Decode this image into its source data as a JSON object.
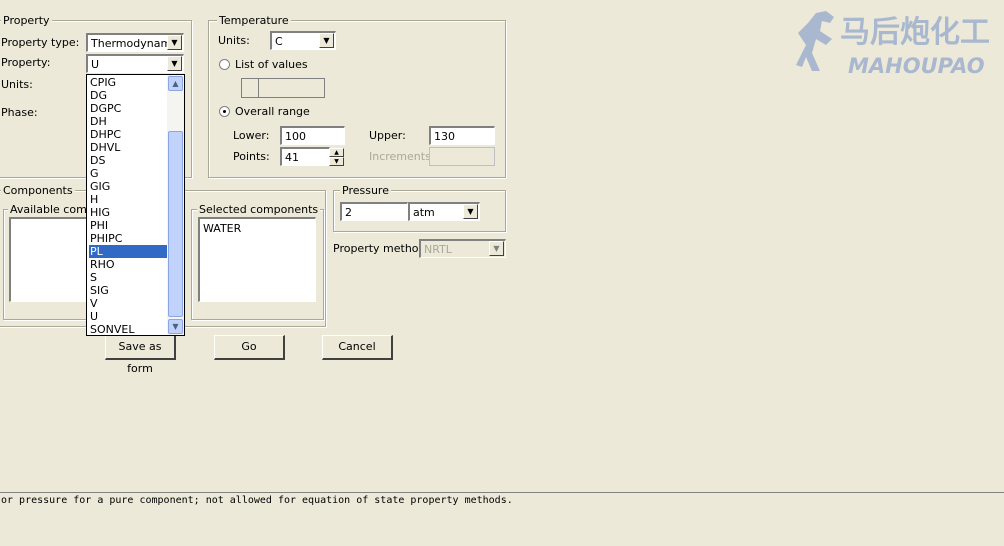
{
  "property": {
    "legend": "Property",
    "type_label": "Property type:",
    "type_value": "Thermodynamic",
    "property_label": "Property:",
    "property_value": "U",
    "units_label": "Units:",
    "phase_label": "Phase:",
    "dropdown_items": [
      "CPIG",
      "DG",
      "DGPC",
      "DH",
      "DHPC",
      "DHVL",
      "DS",
      "G",
      "GIG",
      "H",
      "HIG",
      "PHI",
      "PHIPC",
      "PL",
      "RHO",
      "S",
      "SIG",
      "V",
      "U",
      "SONVEL"
    ],
    "dropdown_selected": "PL"
  },
  "temperature": {
    "legend": "Temperature",
    "units_label": "Units:",
    "units_value": "C",
    "list_of_values_label": "List of values",
    "overall_range_label": "Overall range",
    "lower_label": "Lower:",
    "lower_value": "100",
    "upper_label": "Upper:",
    "upper_value": "130",
    "points_label": "Points:",
    "points_value": "41",
    "increments_label": "Increments:",
    "increments_value": ""
  },
  "components": {
    "legend": "Components",
    "available_legend": "Available compo",
    "selected_legend": "Selected components",
    "selected_items": [
      "WATER"
    ]
  },
  "pressure": {
    "legend": "Pressure",
    "value": "2",
    "units_value": "atm"
  },
  "property_method": {
    "label": "Property method:",
    "value": "NRTL"
  },
  "buttons": {
    "save_as_form": "Save as form",
    "go": "Go",
    "cancel": "Cancel"
  },
  "status_text": "or pressure for a pure component; not allowed for equation of state property methods.",
  "watermark": {
    "chinese": "马后炮化工",
    "latin": "MAHOUPAO"
  },
  "icons": {
    "dropdown_arrow": "▼",
    "scroll_up": "▲",
    "scroll_down": "▼"
  }
}
